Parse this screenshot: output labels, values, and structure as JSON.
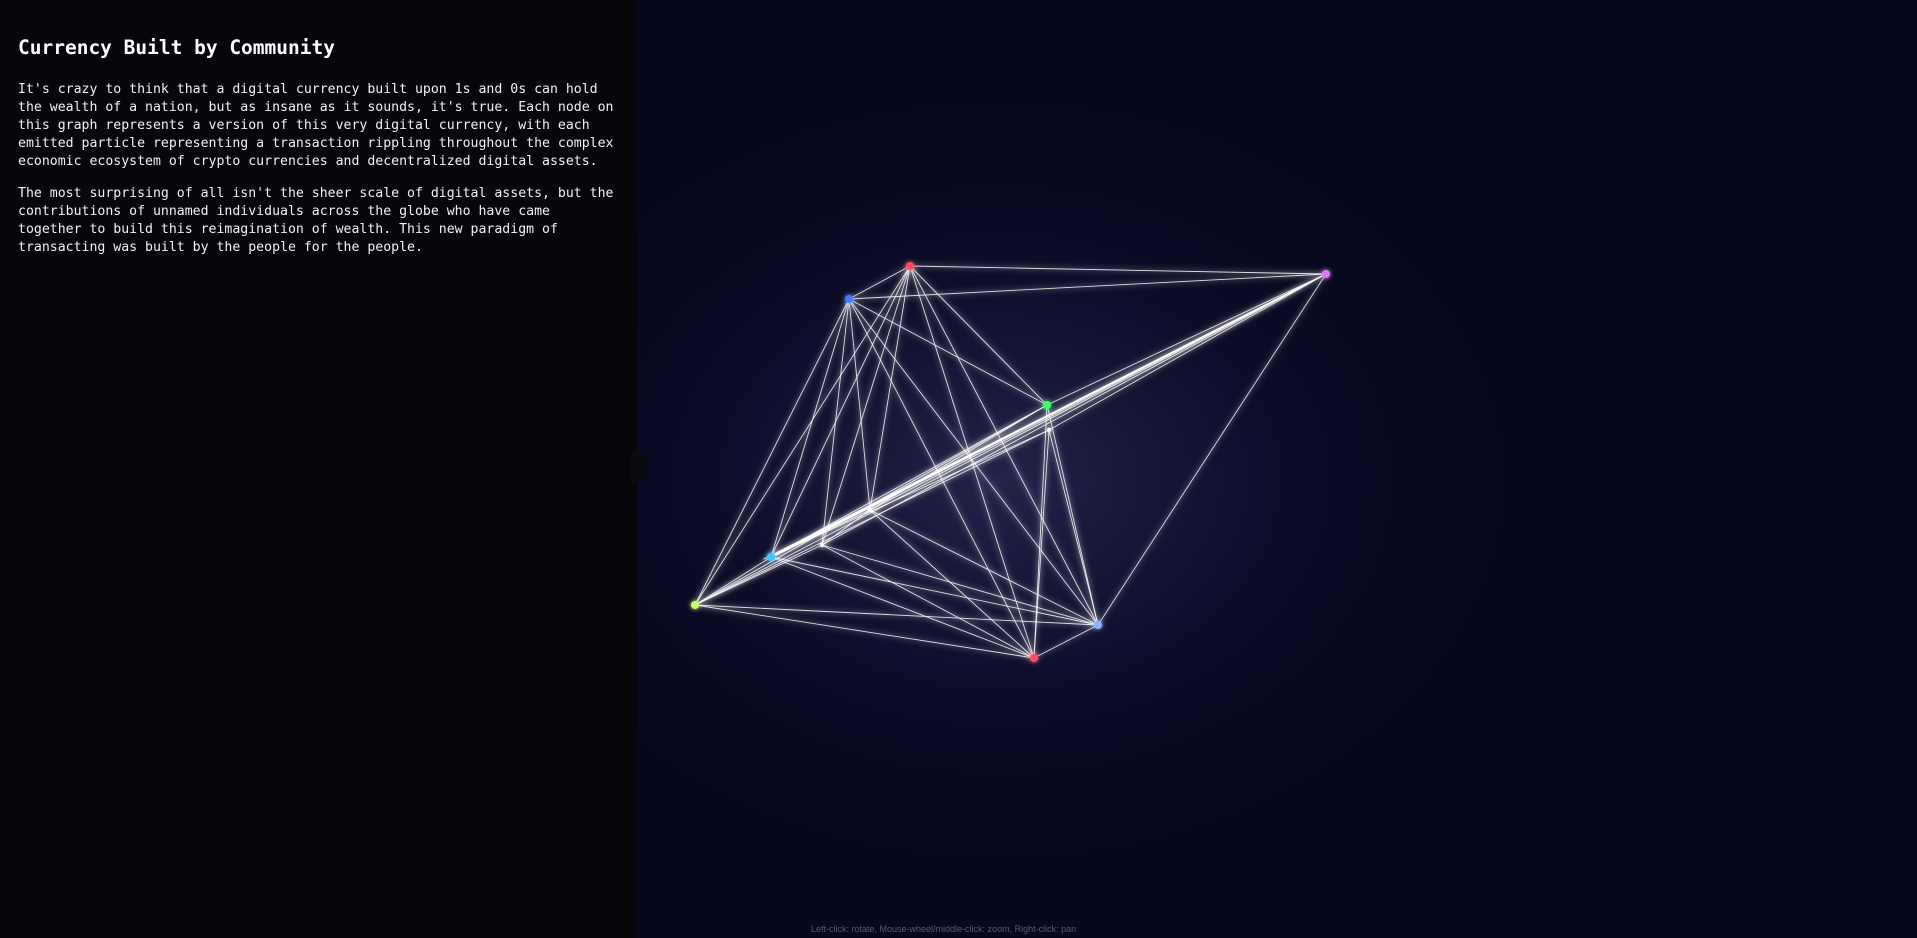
{
  "panel": {
    "title": "Currency Built by Community",
    "paragraphs": [
      "It's crazy to think that a digital currency built upon 1s and 0s can hold the wealth of a nation, but as insane as it sounds, it's true. Each node on this graph represents a version of this very digital currency, with each emitted particle representing a transaction rippling throughout the complex economic ecosystem of crypto currencies and decentralized digital assets.",
      "The most surprising of all isn't the sheer scale of digital assets, but the contributions of unnamed individuals across the globe who have came together to build this reimagination of wealth. This new paradigm of transacting was built by the people for the people."
    ]
  },
  "graph": {
    "background": "#07071d",
    "link_color": "#ffffff",
    "glow_color": "#c9c9ff",
    "nodes": [
      {
        "id": "n1",
        "color": "#ff4d5e"
      },
      {
        "id": "n2",
        "color": "#3f7dff"
      },
      {
        "id": "n3",
        "color": "#d97cf5"
      },
      {
        "id": "n4",
        "color": "#3cff6a"
      },
      {
        "id": "n5",
        "color": "#ffffff"
      },
      {
        "id": "n6",
        "color": "#3bc8ff"
      },
      {
        "id": "n7",
        "color": "#c8ff6e"
      },
      {
        "id": "n8",
        "color": "#ff4d5e"
      },
      {
        "id": "n9",
        "color": "#8fb4ff"
      },
      {
        "id": "n10",
        "color": "#ffffff"
      },
      {
        "id": "n11",
        "color": "#ffffff"
      }
    ],
    "links": [
      [
        "n1",
        "n3"
      ],
      [
        "n1",
        "n2"
      ],
      [
        "n1",
        "n4"
      ],
      [
        "n1",
        "n6"
      ],
      [
        "n1",
        "n7"
      ],
      [
        "n1",
        "n8"
      ],
      [
        "n1",
        "n9"
      ],
      [
        "n1",
        "n10"
      ],
      [
        "n1",
        "n11"
      ],
      [
        "n2",
        "n3"
      ],
      [
        "n2",
        "n4"
      ],
      [
        "n2",
        "n6"
      ],
      [
        "n2",
        "n7"
      ],
      [
        "n2",
        "n8"
      ],
      [
        "n2",
        "n9"
      ],
      [
        "n2",
        "n10"
      ],
      [
        "n2",
        "n11"
      ],
      [
        "n3",
        "n4"
      ],
      [
        "n3",
        "n5"
      ],
      [
        "n3",
        "n6"
      ],
      [
        "n3",
        "n7"
      ],
      [
        "n3",
        "n9"
      ],
      [
        "n3",
        "n10"
      ],
      [
        "n3",
        "n11"
      ],
      [
        "n4",
        "n6"
      ],
      [
        "n4",
        "n7"
      ],
      [
        "n4",
        "n8"
      ],
      [
        "n4",
        "n9"
      ],
      [
        "n4",
        "n10"
      ],
      [
        "n5",
        "n6"
      ],
      [
        "n5",
        "n7"
      ],
      [
        "n5",
        "n8"
      ],
      [
        "n5",
        "n9"
      ],
      [
        "n6",
        "n7"
      ],
      [
        "n6",
        "n8"
      ],
      [
        "n6",
        "n9"
      ],
      [
        "n6",
        "n10"
      ],
      [
        "n7",
        "n8"
      ],
      [
        "n7",
        "n9"
      ],
      [
        "n7",
        "n11"
      ],
      [
        "n8",
        "n9"
      ],
      [
        "n8",
        "n10"
      ],
      [
        "n8",
        "n11"
      ],
      [
        "n9",
        "n10"
      ],
      [
        "n9",
        "n11"
      ],
      [
        "n10",
        "n11"
      ]
    ]
  },
  "hint": "Left-click: rotate, Mouse-wheel/middle-click: zoom, Right-click: pan"
}
